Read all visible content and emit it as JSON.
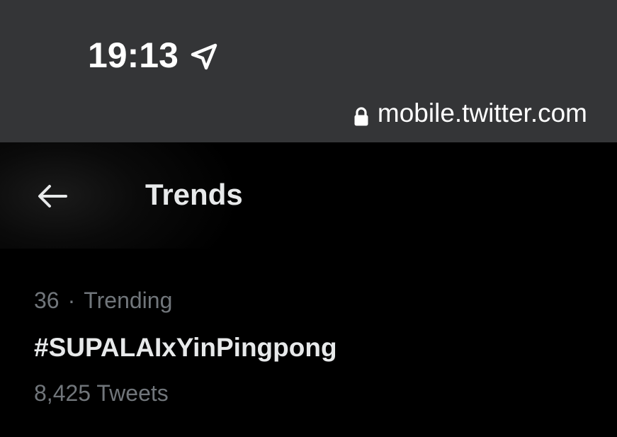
{
  "status_bar": {
    "time": "19:13",
    "location_icon": "location-arrow-icon",
    "lock_icon": "lock-icon",
    "url": "mobile.twitter.com"
  },
  "header": {
    "back_icon": "arrow-left-icon",
    "title": "Trends"
  },
  "trends": [
    {
      "rank": "36",
      "separator": "·",
      "category": "Trending",
      "name": "#SUPALAIxYinPingpong",
      "count": "8,425 Tweets"
    }
  ],
  "colors": {
    "status_bar_bg": "#343537",
    "page_bg": "#000000",
    "primary_text": "#e7e9ea",
    "secondary_text": "#71767b"
  }
}
